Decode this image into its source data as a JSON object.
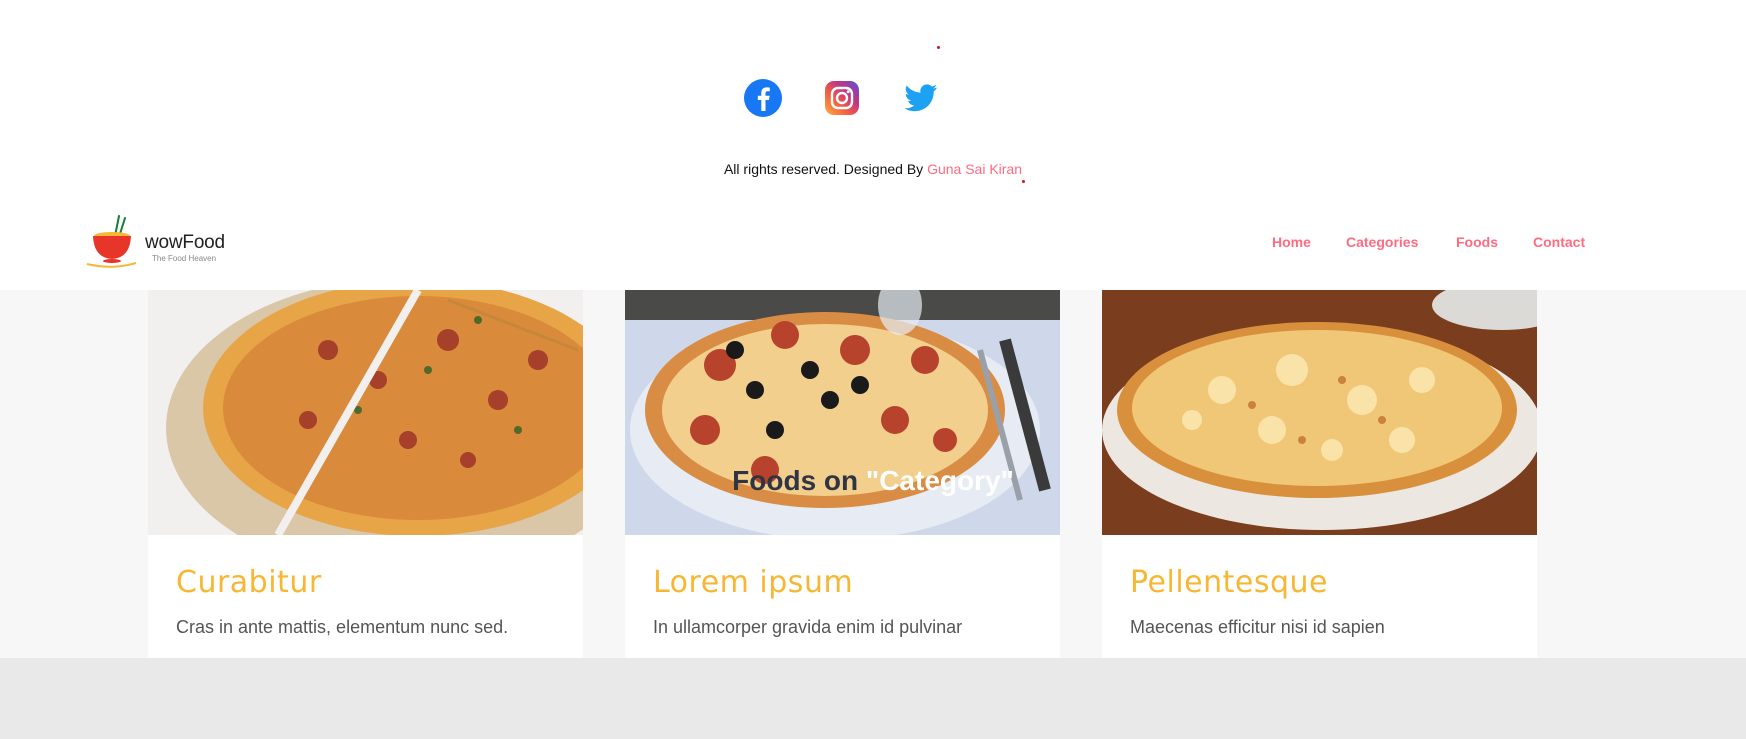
{
  "footer": {
    "social": [
      {
        "name": "facebook",
        "icon": "facebook-icon",
        "color": "#1877f2"
      },
      {
        "name": "instagram",
        "icon": "instagram-icon",
        "color": "#c13584"
      },
      {
        "name": "twitter",
        "icon": "twitter-icon",
        "color": "#1da1f2"
      }
    ],
    "copyright_text": "All rights reserved. Designed By",
    "author_name": "Guna Sai Kiran"
  },
  "navbar": {
    "logo_name": "wowFood",
    "logo_tagline": "The Food Heaven",
    "menu": [
      "Home",
      "Categories",
      "Foods",
      "Contact"
    ],
    "accent_color": "#ff6b81"
  },
  "food_search": {
    "heading_prefix": "Foods on ",
    "heading_highlight": "\"Category\"",
    "cards": [
      {
        "title": "Curabitur",
        "description": "Cras in ante mattis, elementum nunc sed."
      },
      {
        "title": "Lorem ipsum",
        "description": "In ullamcorper gravida enim id pulvinar"
      },
      {
        "title": "Pellentesque",
        "description": "Maecenas efficitur nisi id sapien"
      }
    ],
    "title_color": "#f7b733"
  }
}
